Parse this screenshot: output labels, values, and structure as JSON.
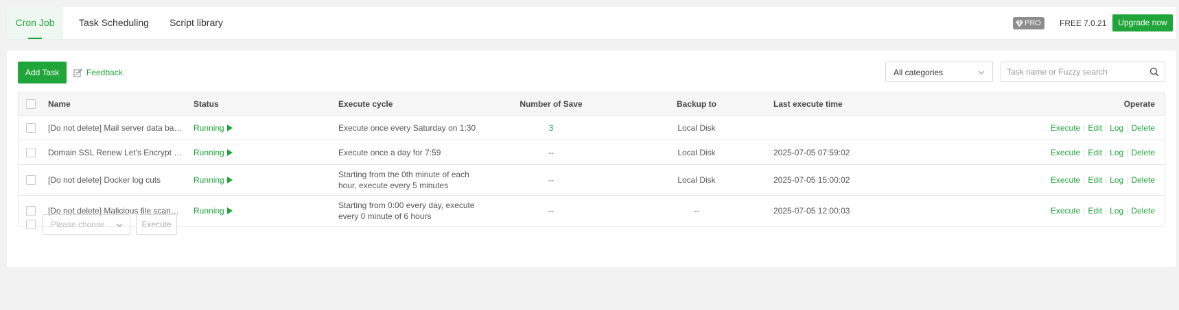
{
  "tabs": [
    {
      "label": "Cron Job",
      "active": true
    },
    {
      "label": "Task Scheduling",
      "active": false
    },
    {
      "label": "Script library",
      "active": false
    }
  ],
  "header": {
    "pro_label": "PRO",
    "free_label": "FREE",
    "version": "7.0.21",
    "upgrade_label": "Upgrade now"
  },
  "toolbar": {
    "add_task_label": "Add Task",
    "feedback_label": "Feedback",
    "category_selected": "All categories",
    "search_placeholder": "Task name or Fuzzy search"
  },
  "table": {
    "columns": {
      "name": "Name",
      "status": "Status",
      "cycle": "Execute cycle",
      "save": "Number of Save",
      "backup": "Backup to",
      "last": "Last execute time",
      "operate": "Operate"
    },
    "rows": [
      {
        "name": "[Do not delete] Mail server data backup",
        "status": "Running",
        "cycle": "Execute once every Saturday on 1:30",
        "save": "3",
        "backup": "Local Disk",
        "last": ""
      },
      {
        "name": "Domain SSL Renew Let's Encrypt Certificate",
        "status": "Running",
        "cycle": "Execute once a day for 7:59",
        "save": "--",
        "backup": "Local Disk",
        "last": "2025-07-05 07:59:02"
      },
      {
        "name": "[Do not delete] Docker log cuts",
        "status": "Running",
        "cycle": "Starting from the 0th minute of each hour, execute every 5 minutes",
        "save": "--",
        "backup": "Local Disk",
        "last": "2025-07-05 15:00:02"
      },
      {
        "name": "[Do not delete] Malicious file scanning task",
        "status": "Running",
        "cycle": "Starting from 0:00 every day, execute every 0 minute of 6 hours",
        "save": "--",
        "backup": "--",
        "last": "2025-07-05 12:00:03"
      }
    ],
    "operations": {
      "execute": "Execute",
      "edit": "Edit",
      "log": "Log",
      "delete": "Delete"
    }
  },
  "batch": {
    "select_placeholder": "Please choose",
    "execute_label": "Execute"
  },
  "colors": {
    "accent": "#20a53a",
    "background": "#f2f2f2",
    "pro_badge": "#8c8c8c"
  },
  "icons": [
    "gem-icon",
    "feedback-edit-icon",
    "chevron-down-icon",
    "search-icon",
    "play-icon"
  ]
}
